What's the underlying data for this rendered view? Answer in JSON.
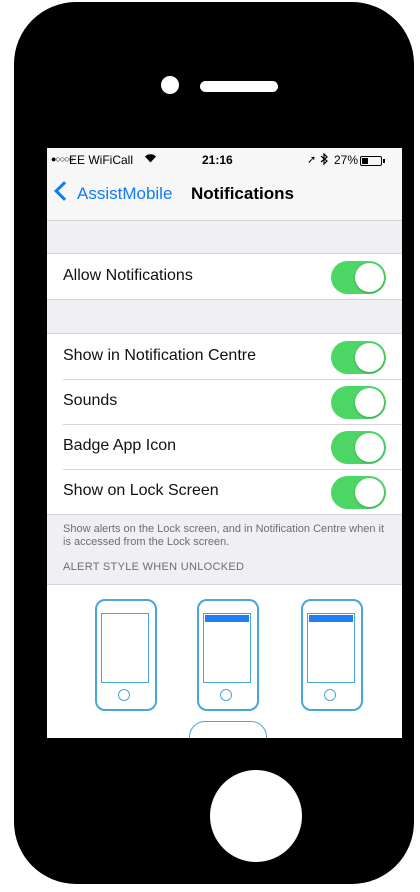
{
  "status_bar": {
    "signal": "●○○○○",
    "carrier": "EE WiFiCall",
    "wifi_icon": "wifi-icon",
    "time": "21:16",
    "location_icon": "location-arrow-icon",
    "bluetooth_icon": "bluetooth-icon",
    "battery_percent": "27%",
    "battery_level": 0.27
  },
  "nav": {
    "back_label": "AssistMobile",
    "title": "Notifications"
  },
  "settings": {
    "allow": {
      "label": "Allow Notifications",
      "on": true
    },
    "rows": [
      {
        "label": "Show in Notification Centre",
        "on": true
      },
      {
        "label": "Sounds",
        "on": true
      },
      {
        "label": "Badge App Icon",
        "on": true
      },
      {
        "label": "Show on Lock Screen",
        "on": true
      }
    ],
    "lock_screen_note": "Show alerts on the Lock screen, and in Notification Centre when it is accessed from the Lock screen.",
    "alert_style_header": "ALERT STYLE WHEN UNLOCKED"
  },
  "alert_styles": [
    {
      "style": "none",
      "banner": false
    },
    {
      "style": "banners",
      "banner": true
    },
    {
      "style": "alerts",
      "banner": true
    }
  ],
  "colors": {
    "accent": "#127bf5",
    "toggle_on": "#4cd664",
    "device_body": "#000000"
  }
}
